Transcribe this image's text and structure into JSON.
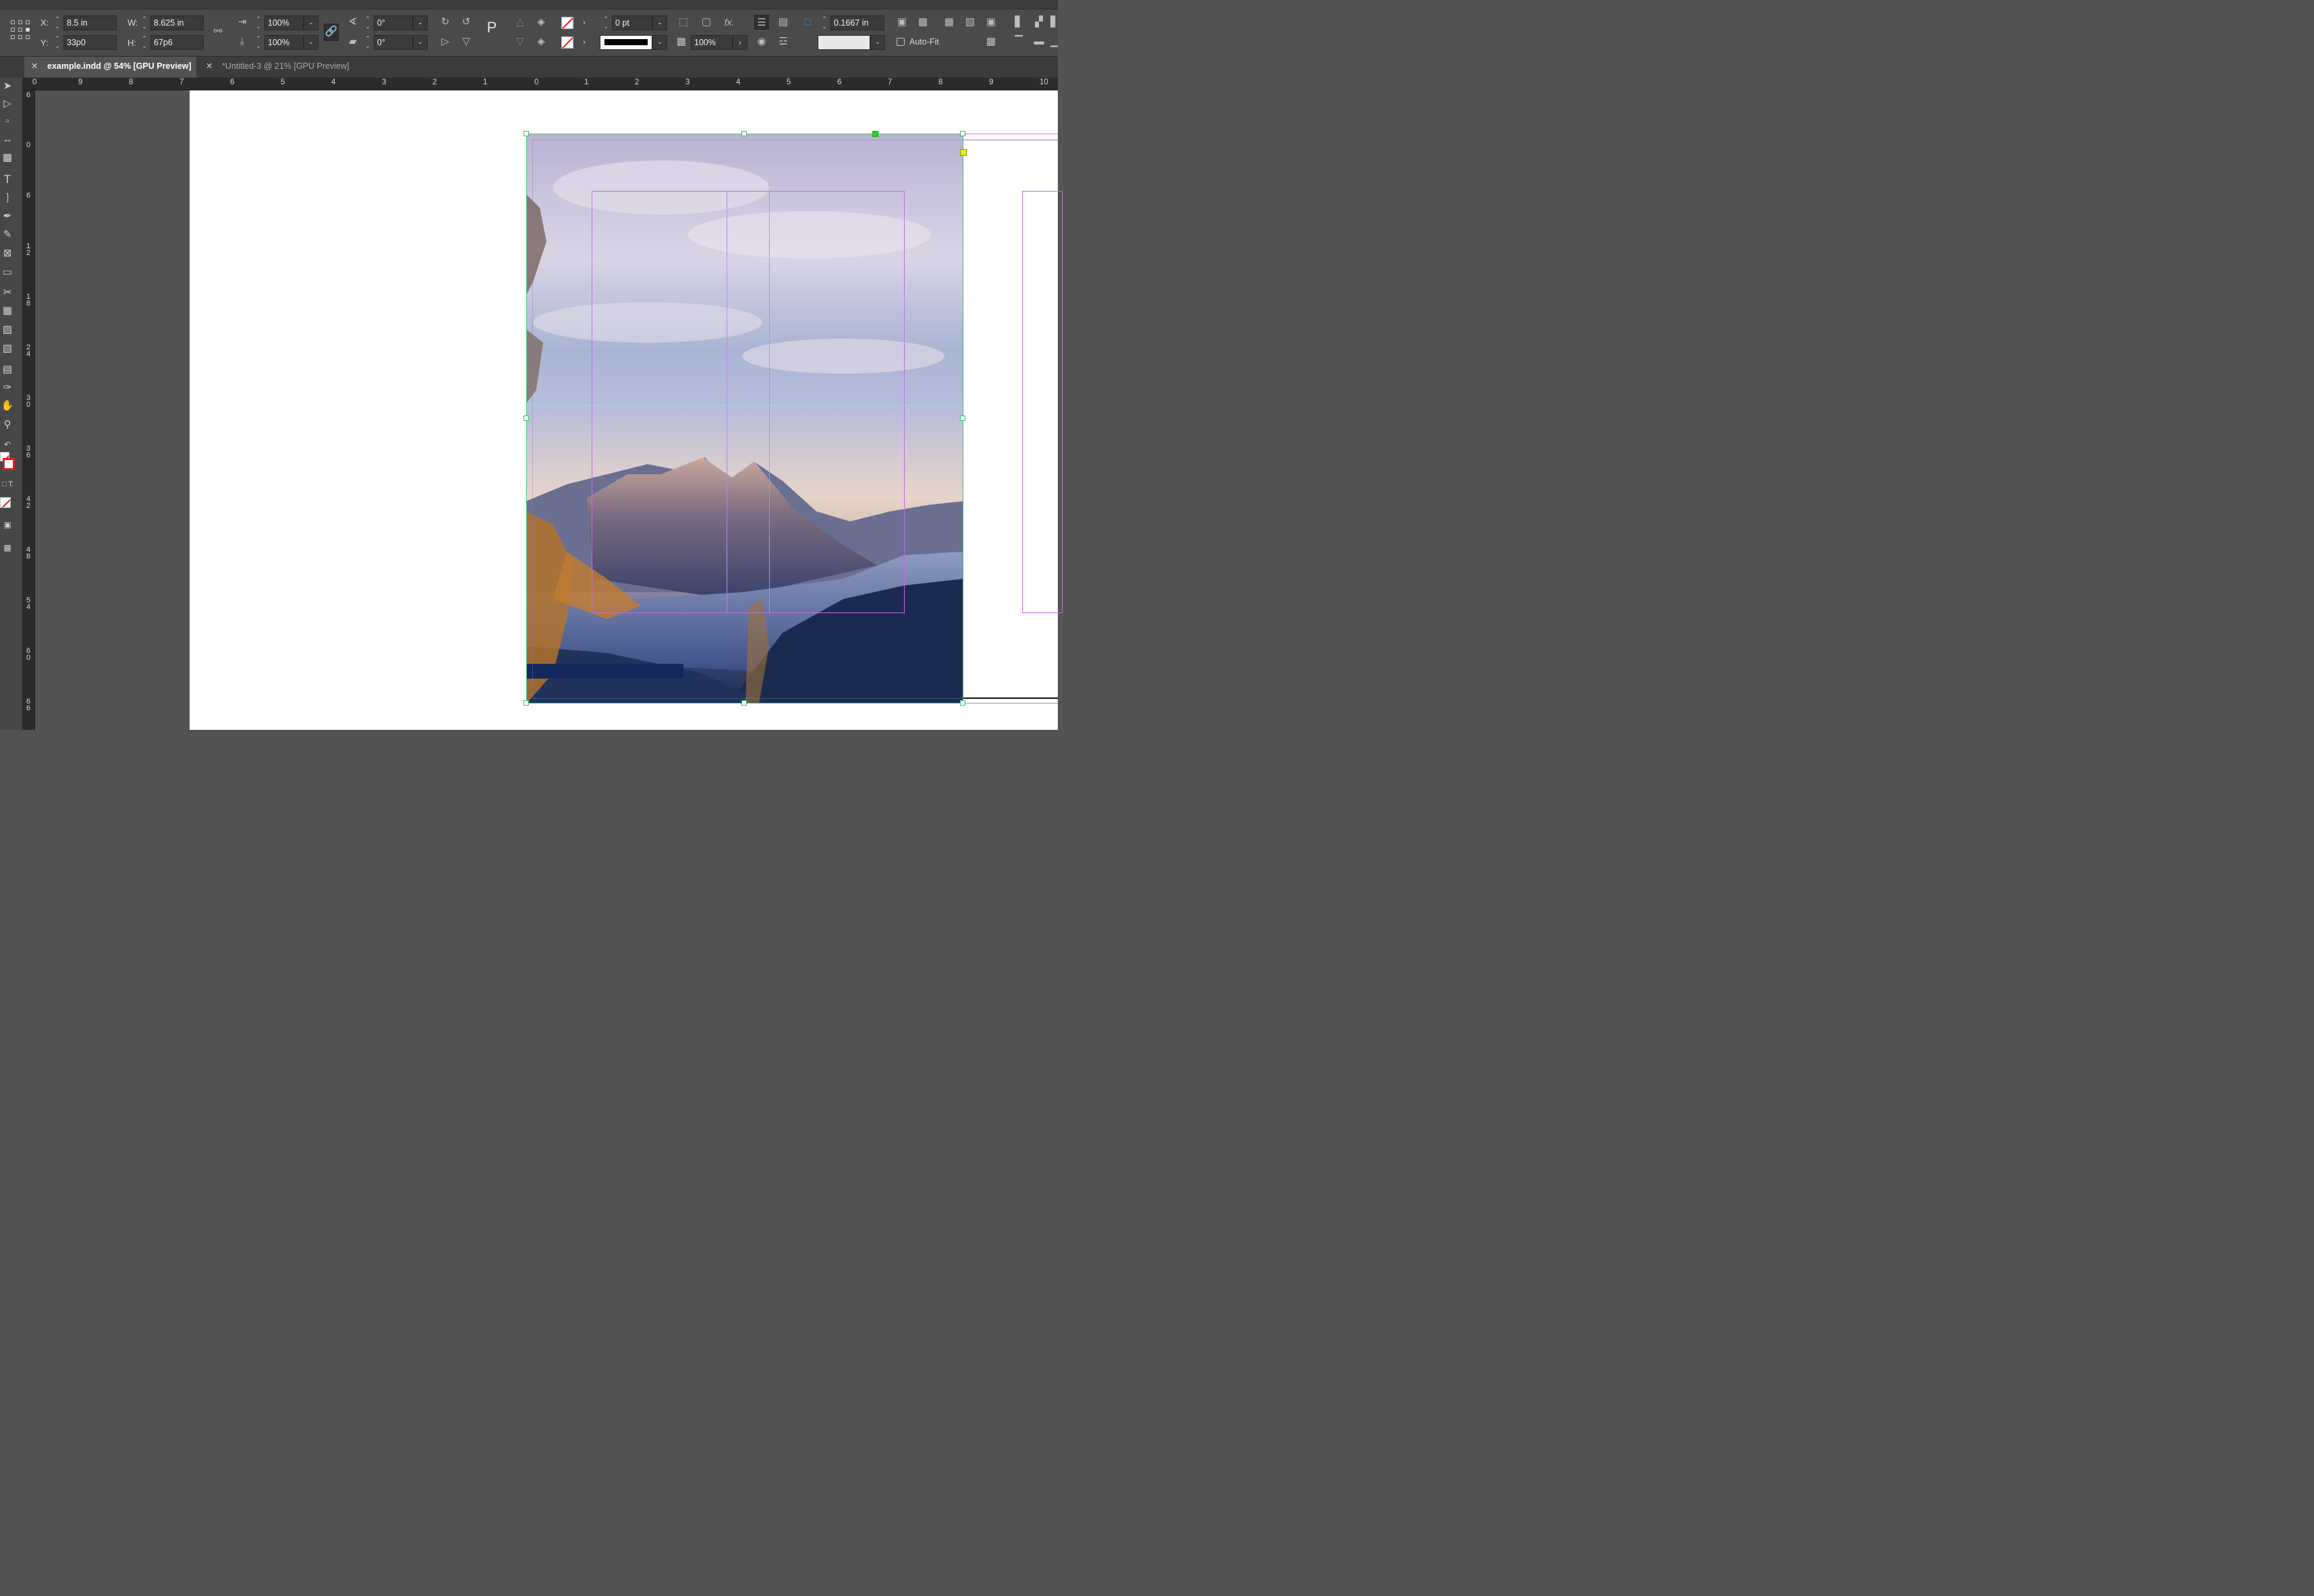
{
  "control_panel": {
    "x_label": "X:",
    "x_value": "8.5 in",
    "y_label": "Y:",
    "y_value": "33p0",
    "w_label": "W:",
    "w_value": "8.625 in",
    "h_label": "H:",
    "h_value": "67p6",
    "scale_x": "100%",
    "scale_y": "100%",
    "rotation": "0°",
    "shear": "0°",
    "stroke_weight": "0 pt",
    "opacity": "100%",
    "corner_size": "0.1667 in",
    "autofit_label": "Auto-Fit",
    "fx_label": "fx."
  },
  "tabs": [
    {
      "label": "example.indd @ 54% [GPU Preview]",
      "active": true
    },
    {
      "label": "*Untitled-3 @ 21% [GPU Preview]",
      "active": false
    }
  ],
  "ruler": {
    "horizontal": [
      "0",
      "9",
      "8",
      "7",
      "6",
      "5",
      "4",
      "3",
      "2",
      "1",
      "0",
      "1",
      "2",
      "3",
      "4",
      "5",
      "6",
      "7",
      "8",
      "9",
      "10"
    ],
    "vertical": [
      "6",
      "0",
      "6",
      "1 2",
      "1 8",
      "2 4",
      "3 0",
      "3 6",
      "4 2",
      "4 8",
      "5 4",
      "6 0",
      "6 6"
    ]
  },
  "tools": [
    "selection-tool",
    "direct-selection-tool",
    "page-tool",
    "gap-tool",
    "content-collector-tool",
    "type-tool",
    "line-tool",
    "pen-tool",
    "pencil-tool",
    "rectangle-frame-tool",
    "rectangle-tool",
    "scissors-tool",
    "free-transform-tool",
    "gradient-swatch-tool",
    "gradient-feather-tool",
    "note-tool",
    "eyedropper-tool",
    "hand-tool",
    "zoom-tool"
  ],
  "colors": {
    "frame_edge": "#44d47a",
    "margin_guide": "#c86ae0",
    "ruler_guide": "#7ce4e4",
    "pasteboard": "#535353",
    "panel": "#4a4a4a"
  }
}
